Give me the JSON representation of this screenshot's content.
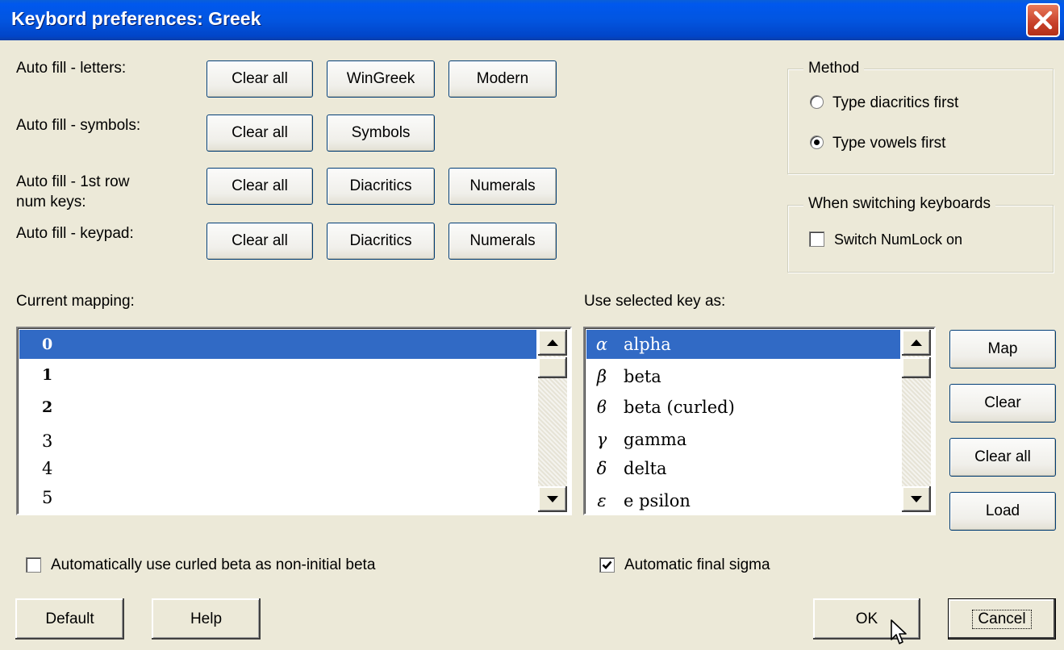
{
  "window": {
    "title": "Keybord preferences: Greek"
  },
  "autofill": {
    "letters": {
      "label": "Auto fill - letters:",
      "buttons": [
        "Clear all",
        "WinGreek",
        "Modern"
      ]
    },
    "symbols": {
      "label": "Auto fill - symbols:",
      "buttons": [
        "Clear all",
        "Symbols"
      ]
    },
    "numkeys": {
      "label_line1": "Auto fill - 1st row",
      "label_line2": "num keys:",
      "buttons": [
        "Clear all",
        "Diacritics",
        "Numerals"
      ]
    },
    "keypad": {
      "label": "Auto fill - keypad:",
      "buttons": [
        "Clear all",
        "Diacritics",
        "Numerals"
      ]
    }
  },
  "method": {
    "legend": "Method",
    "options": [
      {
        "label": "Type diacritics first",
        "selected": false
      },
      {
        "label": "Type vowels first",
        "selected": true
      }
    ]
  },
  "switching": {
    "legend": "When switching keyboards",
    "numlock_label": "Switch NumLock on",
    "numlock_checked": false
  },
  "current_mapping": {
    "label": "Current mapping:",
    "items": [
      "0",
      "1",
      "2",
      "3",
      "4",
      "5"
    ],
    "selected_index": 0
  },
  "use_key": {
    "label": "Use selected key as:",
    "items": [
      {
        "glyph": "α",
        "name": "alpha"
      },
      {
        "glyph": "β",
        "name": "beta"
      },
      {
        "glyph": "ϐ",
        "name": "beta (curled)"
      },
      {
        "glyph": "γ",
        "name": "gamma"
      },
      {
        "glyph": "δ",
        "name": "delta"
      },
      {
        "glyph": "ε",
        "name": "e psilon"
      }
    ],
    "selected_index": 0
  },
  "side_buttons": [
    "Map",
    "Clear",
    "Clear all",
    "Load"
  ],
  "options": {
    "curled_beta": {
      "label": "Automatically use curled beta as non-initial beta",
      "checked": false
    },
    "final_sigma": {
      "label": "Automatic final sigma",
      "checked": true
    }
  },
  "footer": {
    "default": "Default",
    "help": "Help",
    "ok": "OK",
    "cancel": "Cancel"
  },
  "colors": {
    "title_bar": "#0255e0",
    "selection": "#316ac5",
    "dialog_bg": "#ece9d8",
    "close_button": "#c7402a"
  }
}
